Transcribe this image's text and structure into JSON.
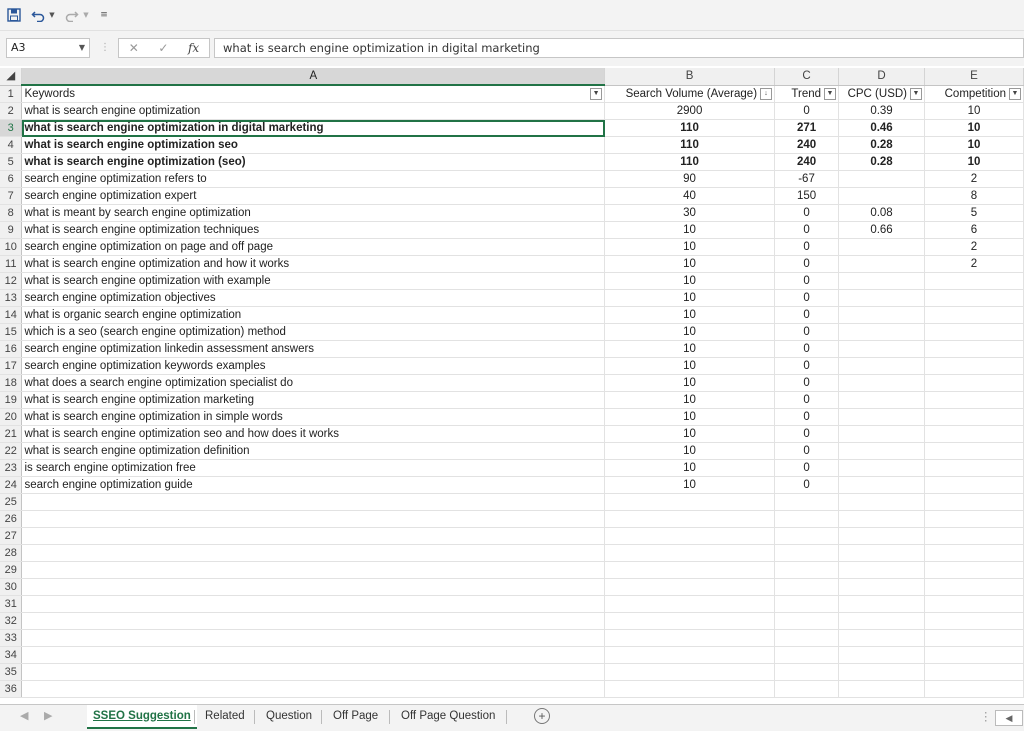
{
  "qat": {
    "save_icon": "save-icon",
    "undo_icon": "undo-icon",
    "redo_icon": "redo-icon",
    "customize_icon": "customize-icon"
  },
  "formula_bar": {
    "name_box": "A3",
    "fx_label": "fx",
    "content": "what is search engine optimization in digital marketing"
  },
  "columns": [
    "A",
    "B",
    "C",
    "D",
    "E"
  ],
  "header_row": {
    "row": "1",
    "keywords": "Keywords",
    "volume": "Search Volume (Average)",
    "trend": "Trend",
    "cpc": "CPC (USD)",
    "competition": "Competition"
  },
  "rows": [
    {
      "n": "2",
      "kw": "what is search engine optimization",
      "vol": "2900",
      "trend": "0",
      "cpc": "0.39",
      "comp": "10"
    },
    {
      "n": "3",
      "kw": "what is search engine optimization in digital marketing",
      "vol": "110",
      "trend": "271",
      "cpc": "0.46",
      "comp": "10"
    },
    {
      "n": "4",
      "kw": "what is search engine optimization seo",
      "vol": "110",
      "trend": "240",
      "cpc": "0.28",
      "comp": "10"
    },
    {
      "n": "5",
      "kw": "what is search engine optimization (seo)",
      "vol": "110",
      "trend": "240",
      "cpc": "0.28",
      "comp": "10"
    },
    {
      "n": "6",
      "kw": "search engine optimization refers to",
      "vol": "90",
      "trend": "-67",
      "cpc": "",
      "comp": "2"
    },
    {
      "n": "7",
      "kw": "search engine optimization expert",
      "vol": "40",
      "trend": "150",
      "cpc": "",
      "comp": "8"
    },
    {
      "n": "8",
      "kw": "what is meant by search engine optimization",
      "vol": "30",
      "trend": "0",
      "cpc": "0.08",
      "comp": "5"
    },
    {
      "n": "9",
      "kw": "what is search engine optimization techniques",
      "vol": "10",
      "trend": "0",
      "cpc": "0.66",
      "comp": "6"
    },
    {
      "n": "10",
      "kw": "search engine optimization on page and off page",
      "vol": "10",
      "trend": "0",
      "cpc": "",
      "comp": "2"
    },
    {
      "n": "11",
      "kw": "what is search engine optimization and how it works",
      "vol": "10",
      "trend": "0",
      "cpc": "",
      "comp": "2"
    },
    {
      "n": "12",
      "kw": "what is search engine optimization with example",
      "vol": "10",
      "trend": "0",
      "cpc": "",
      "comp": ""
    },
    {
      "n": "13",
      "kw": "search engine optimization objectives",
      "vol": "10",
      "trend": "0",
      "cpc": "",
      "comp": ""
    },
    {
      "n": "14",
      "kw": "what is organic search engine optimization",
      "vol": "10",
      "trend": "0",
      "cpc": "",
      "comp": ""
    },
    {
      "n": "15",
      "kw": "which is a seo (search engine optimization) method",
      "vol": "10",
      "trend": "0",
      "cpc": "",
      "comp": ""
    },
    {
      "n": "16",
      "kw": "search engine optimization linkedin assessment answers",
      "vol": "10",
      "trend": "0",
      "cpc": "",
      "comp": ""
    },
    {
      "n": "17",
      "kw": "search engine optimization keywords examples",
      "vol": "10",
      "trend": "0",
      "cpc": "",
      "comp": ""
    },
    {
      "n": "18",
      "kw": "what does a search engine optimization specialist do",
      "vol": "10",
      "trend": "0",
      "cpc": "",
      "comp": ""
    },
    {
      "n": "19",
      "kw": "what is search engine optimization marketing",
      "vol": "10",
      "trend": "0",
      "cpc": "",
      "comp": ""
    },
    {
      "n": "20",
      "kw": "what is search engine optimization in simple words",
      "vol": "10",
      "trend": "0",
      "cpc": "",
      "comp": ""
    },
    {
      "n": "21",
      "kw": "what is search engine optimization seo and how does it works",
      "vol": "10",
      "trend": "0",
      "cpc": "",
      "comp": ""
    },
    {
      "n": "22",
      "kw": "what is search engine optimization definition",
      "vol": "10",
      "trend": "0",
      "cpc": "",
      "comp": ""
    },
    {
      "n": "23",
      "kw": "is search engine optimization free",
      "vol": "10",
      "trend": "0",
      "cpc": "",
      "comp": ""
    },
    {
      "n": "24",
      "kw": "search engine optimization guide",
      "vol": "10",
      "trend": "0",
      "cpc": "",
      "comp": ""
    }
  ],
  "bold_rows": [
    "3",
    "4",
    "5"
  ],
  "empty_rows": [
    "25",
    "26",
    "27",
    "28",
    "29",
    "30",
    "31",
    "32",
    "33",
    "34",
    "35",
    "36"
  ],
  "sheet_tabs": [
    "SSEO Suggestion",
    "Related",
    "Question",
    "Off Page",
    "Off Page Question"
  ],
  "active_tab": "SSEO Suggestion",
  "colors": {
    "accent": "#217346",
    "header_bg": "#f0f0f0",
    "selected_header": "#d7d7d7"
  }
}
